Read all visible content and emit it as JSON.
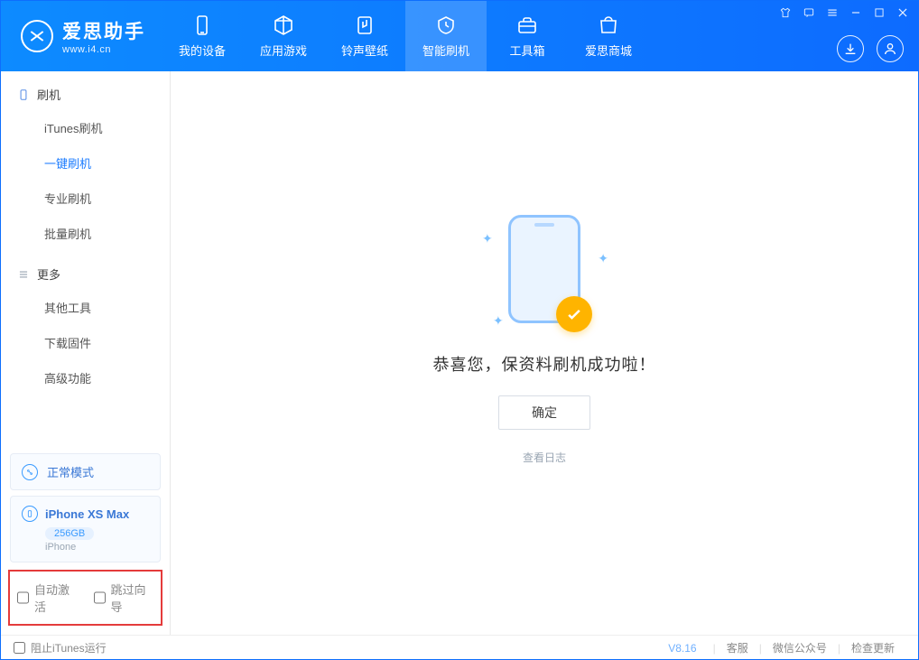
{
  "brand": {
    "name": "爱思助手",
    "url": "www.i4.cn"
  },
  "nav": {
    "items": [
      {
        "label": "我的设备"
      },
      {
        "label": "应用游戏"
      },
      {
        "label": "铃声壁纸"
      },
      {
        "label": "智能刷机"
      },
      {
        "label": "工具箱"
      },
      {
        "label": "爱思商城"
      }
    ],
    "activeIndex": 3
  },
  "sidebar": {
    "groups": [
      {
        "title": "刷机",
        "items": [
          "iTunes刷机",
          "一键刷机",
          "专业刷机",
          "批量刷机"
        ],
        "activeIndex": 1
      },
      {
        "title": "更多",
        "items": [
          "其他工具",
          "下载固件",
          "高级功能"
        ]
      }
    ],
    "mode": {
      "label": "正常模式"
    },
    "device": {
      "name": "iPhone XS Max",
      "capacity": "256GB",
      "type": "iPhone"
    },
    "options": {
      "autoActivate": "自动激活",
      "skipGuide": "跳过向导"
    }
  },
  "main": {
    "title": "恭喜您，保资料刷机成功啦！",
    "okLabel": "确定",
    "logLink": "查看日志"
  },
  "footer": {
    "blockItunes": "阻止iTunes运行",
    "version": "V8.16",
    "links": [
      "客服",
      "微信公众号",
      "检查更新"
    ]
  }
}
